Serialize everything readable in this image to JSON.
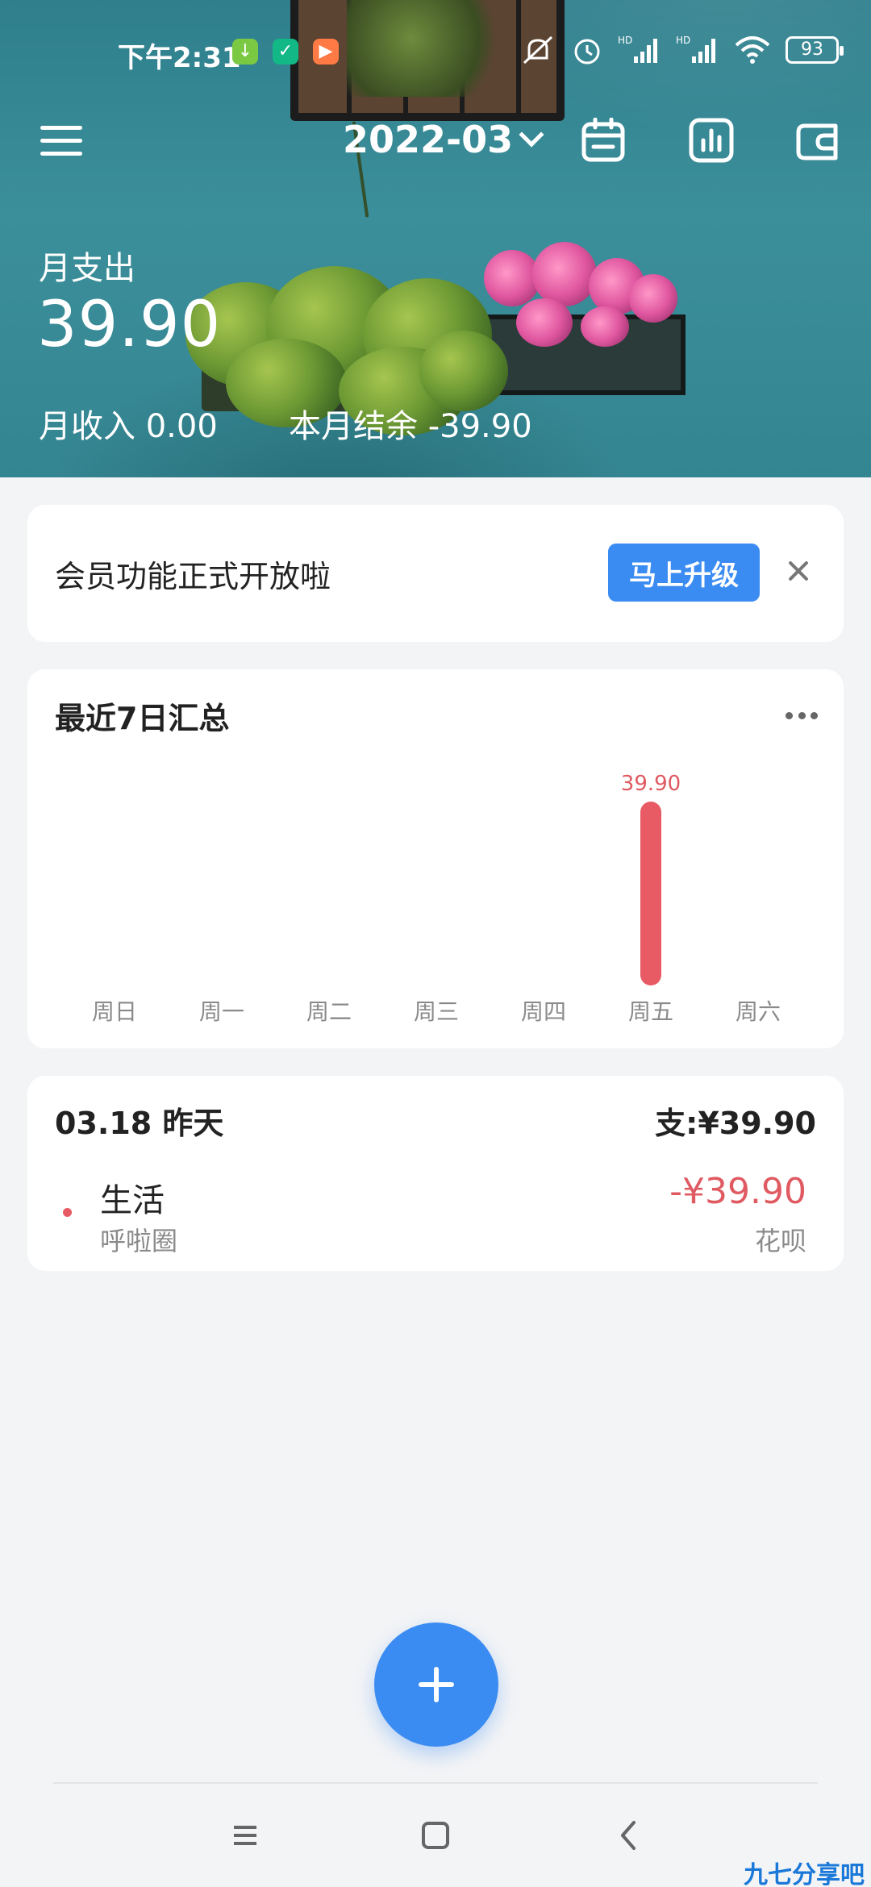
{
  "status_bar": {
    "time": "下午2:31",
    "battery": "93",
    "colors": {
      "download_app": "#7bc943",
      "shield_app": "#12b886",
      "video_app": "#ff7a45"
    }
  },
  "top_bar": {
    "month": "2022-03",
    "icons": [
      "menu-icon",
      "calendar-icon",
      "bar-chart-icon",
      "wallet-icon"
    ]
  },
  "summary": {
    "expense_label": "月支出",
    "expense_value": "39.90",
    "income_text": "月收入 0.00",
    "balance_text": "本月结余 -39.90"
  },
  "promo": {
    "text": "会员功能正式开放啦",
    "button_label": "马上升级"
  },
  "weekly_chart": {
    "title": "最近7日汇总"
  },
  "chart_data": {
    "type": "bar",
    "title": "最近7日汇总",
    "categories": [
      "周日",
      "周一",
      "周二",
      "周三",
      "周四",
      "周五",
      "周六"
    ],
    "values": [
      0,
      0,
      0,
      0,
      0,
      39.9,
      0
    ],
    "value_labels": [
      "",
      "",
      "",
      "",
      "",
      "39.90",
      ""
    ],
    "bar_color": "#e85a64",
    "label_color": "#e05a62",
    "grid": false,
    "legend": "none"
  },
  "day_group": {
    "date": "03.18 昨天",
    "total": "支:¥39.90",
    "transactions": [
      {
        "category": "生活",
        "note": "呼啦圈",
        "amount": "-¥39.90",
        "account": "花呗"
      }
    ]
  },
  "colors": {
    "accent": "#3b8cf2",
    "expense": "#e05a62",
    "background": "#f3f4f6"
  },
  "watermark": "九七分享吧"
}
